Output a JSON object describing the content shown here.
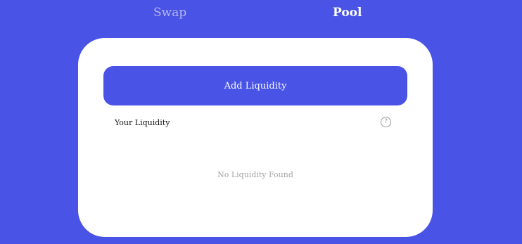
{
  "nav": {
    "tabs": [
      {
        "label": "Swap",
        "active": false
      },
      {
        "label": "Pool",
        "active": true
      }
    ]
  },
  "pool": {
    "add_liquidity_label": "Add Liquidity",
    "your_liquidity_label": "Your Liquidity",
    "help_icon_glyph": "?",
    "empty_message": "No Liquidity Found"
  },
  "colors": {
    "background": "#4953e5",
    "card": "#ffffff",
    "accent": "#4953e5",
    "inactive_tab": "#b3b7ef",
    "muted_text": "#a4a4a4"
  },
  "icons": {
    "help": "question-circle-icon"
  }
}
